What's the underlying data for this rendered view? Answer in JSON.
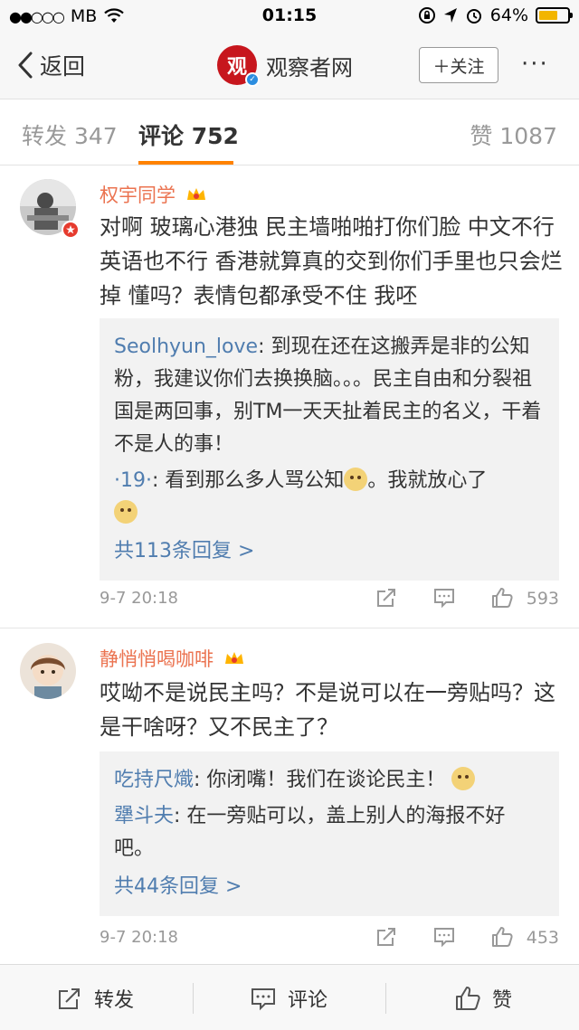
{
  "status_bar": {
    "carrier": "MB",
    "time": "01:15",
    "battery": "64%",
    "battery_level": 0.64
  },
  "nav": {
    "back_label": "返回",
    "logo_char": "观",
    "title": "观察者网",
    "follow_label": "＋关注",
    "more_label": "···"
  },
  "tabs": [
    {
      "label": "转发 347"
    },
    {
      "label": "评论 752"
    },
    {
      "label": "赞 1087"
    }
  ],
  "comments": [
    {
      "username": "权宇同学",
      "text": "对啊 玻璃心港独 民主墙啪啪打你们脸 中文不行英语也不行 香港就算真的交到你们手里也只会烂掉 懂吗？表情包都承受不住 我呸",
      "replies": [
        {
          "name": "Seolhyun_love",
          "text": "到现在还在这搬弄是非的公知粉，我建议你们去换换脑。。。民主自由和分裂祖国是两回事，别TM一天天扯着民主的名义，干着不是人的事！"
        },
        {
          "name": "·19·",
          "text": "看到那么多人骂公知",
          "text2": "。我就放心了"
        }
      ],
      "more_replies": "共113条回复 >",
      "time": "9-7 20:18",
      "likes": "593"
    },
    {
      "username": "静悄悄喝咖啡",
      "text": "哎呦不是说民主吗？不是说可以在一旁贴吗？这是干啥呀？又不民主了？",
      "replies": [
        {
          "name": "吃持尺熾",
          "text": "你闭嘴！我们在谈论民主！"
        },
        {
          "name": "犟斗夫",
          "text": "在一旁贴可以，盖上别人的海报不好吧。"
        }
      ],
      "more_replies": "共44条回复 >",
      "time": "9-7 20:18",
      "likes": "453"
    }
  ],
  "toolbar": {
    "repost": "转发",
    "comment": "评论",
    "like": "赞"
  },
  "colors": {
    "username": "#eb7350",
    "link": "#507daf",
    "accent": "#ff8200"
  }
}
